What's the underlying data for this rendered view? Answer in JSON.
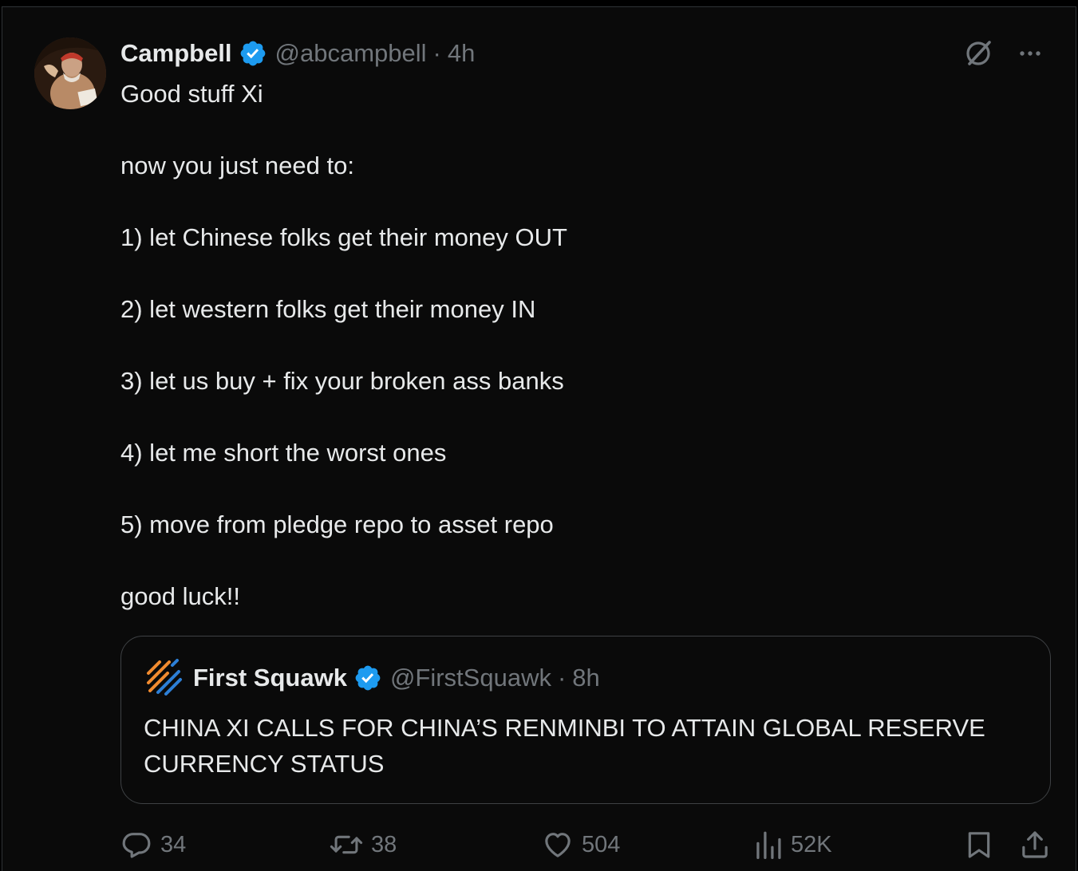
{
  "tweet": {
    "author_name": "Campbell",
    "handle": "@abcampbell",
    "separator": "·",
    "time": "4h",
    "lines": [
      "Good stuff Xi",
      "",
      "now you just need to:",
      "",
      "1) let Chinese folks get their money OUT",
      "",
      "2) let western folks get their money IN",
      "",
      "3) let us buy + fix your broken ass banks",
      "",
      "4) let me short the worst ones",
      "",
      "5) move from pledge repo to asset repo",
      "",
      "good luck!!"
    ]
  },
  "quoted": {
    "author_name": "First Squawk",
    "handle": "@FirstSquawk",
    "separator": "·",
    "time": "8h",
    "text": "CHINA XI CALLS FOR CHINA’S RENMINBI TO ATTAIN GLOBAL RESERVE CURRENCY STATUS"
  },
  "actions": {
    "replies": "34",
    "reposts": "38",
    "likes": "504",
    "views": "52K"
  },
  "icons": {
    "top_right": [
      "grok-icon",
      "more-icon"
    ],
    "bottom": [
      "reply-icon",
      "repost-icon",
      "like-icon",
      "views-icon",
      "bookmark-icon",
      "share-icon"
    ]
  },
  "colors": {
    "verified_blue": "#1d9bf0",
    "text": "#e7e9ea",
    "muted": "#71767b",
    "background": "#0a0a0a"
  }
}
